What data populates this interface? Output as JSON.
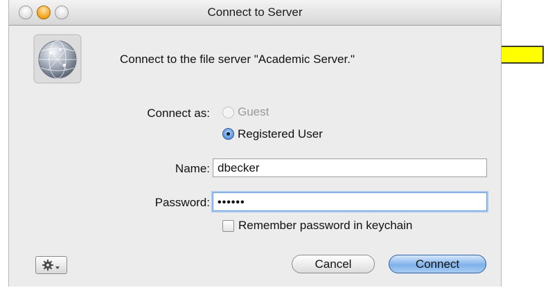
{
  "window": {
    "title": "Connect to Server"
  },
  "message": "Connect to the file server \"Academic Server.\"",
  "connect_as": {
    "label": "Connect as:",
    "options": [
      {
        "label": "Guest",
        "selected": false,
        "enabled": false
      },
      {
        "label": "Registered User",
        "selected": true,
        "enabled": true
      }
    ]
  },
  "name_field": {
    "label": "Name:",
    "value": "dbecker"
  },
  "password_field": {
    "label": "Password:",
    "value": "••••••"
  },
  "remember": {
    "label": "Remember password in keychain",
    "checked": false
  },
  "buttons": {
    "action_menu_icon": "gear-icon",
    "cancel": "Cancel",
    "connect": "Connect"
  },
  "colors": {
    "annotation_arrow": "#ffff00",
    "default_button": "#7fb2ea"
  }
}
